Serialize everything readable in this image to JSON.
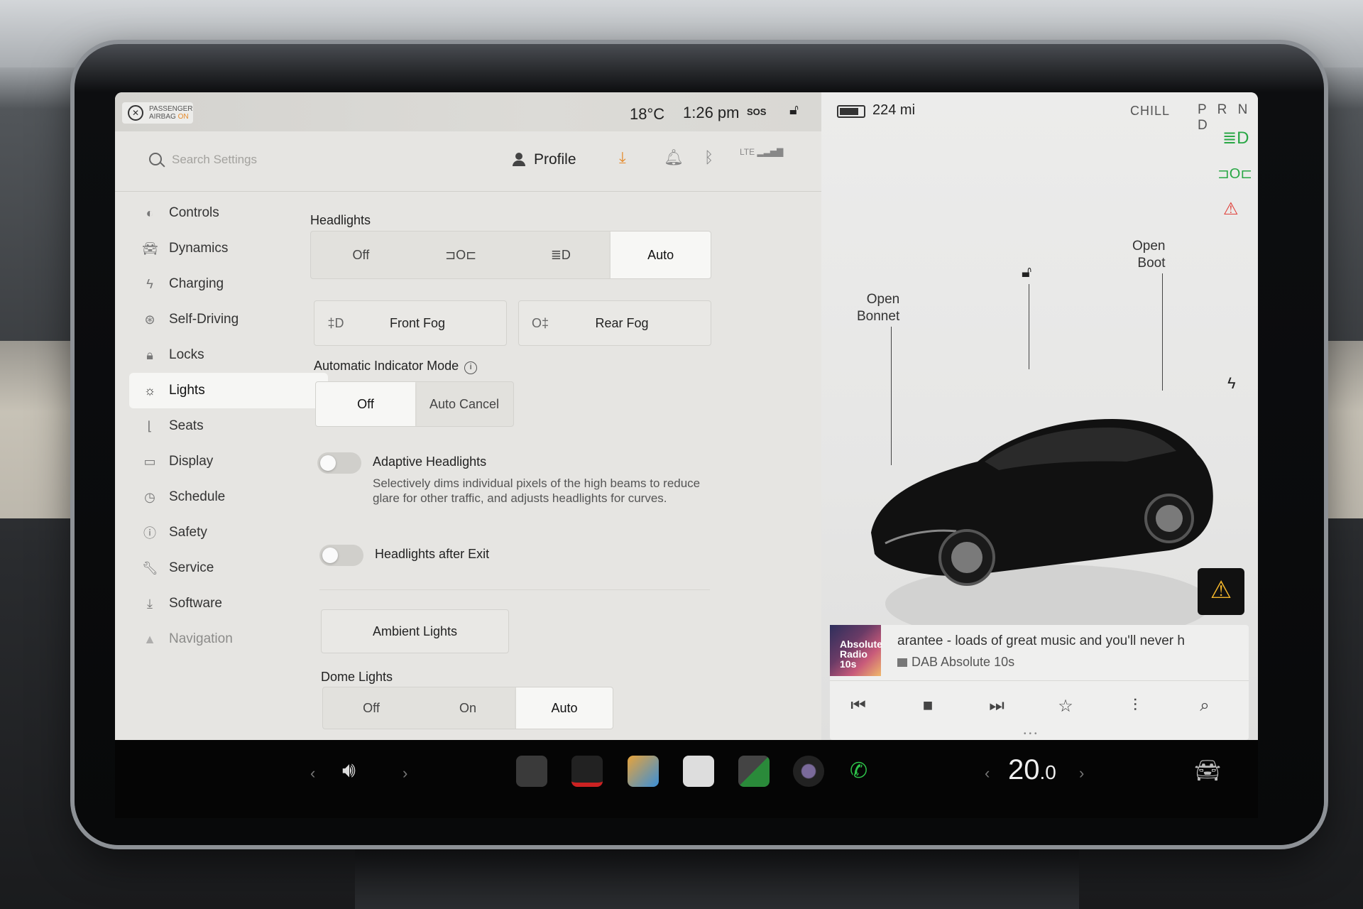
{
  "status": {
    "airbag_line1": "PASSENGER",
    "airbag_line2": "AIRBAG",
    "airbag_state": "ON",
    "temperature": "18°C",
    "time": "1:26 pm",
    "sos": "SOS"
  },
  "header": {
    "search_placeholder": "Search Settings",
    "profile_label": "Profile",
    "lte_label": "LTE"
  },
  "sidebar": {
    "items": [
      {
        "label": "Controls",
        "icon": "toggle-icon"
      },
      {
        "label": "Dynamics",
        "icon": "car-icon"
      },
      {
        "label": "Charging",
        "icon": "bolt-icon"
      },
      {
        "label": "Self-Driving",
        "icon": "steering-wheel-icon"
      },
      {
        "label": "Locks",
        "icon": "lock-icon"
      },
      {
        "label": "Lights",
        "icon": "sun-icon"
      },
      {
        "label": "Seats",
        "icon": "seat-icon"
      },
      {
        "label": "Display",
        "icon": "display-icon"
      },
      {
        "label": "Schedule",
        "icon": "clock-icon"
      },
      {
        "label": "Safety",
        "icon": "info-icon"
      },
      {
        "label": "Service",
        "icon": "wrench-icon"
      },
      {
        "label": "Software",
        "icon": "download-icon"
      },
      {
        "label": "Navigation",
        "icon": "navigation-icon"
      }
    ],
    "active": "Lights"
  },
  "lights": {
    "headlights_label": "Headlights",
    "headlights_options": [
      "Off",
      "parking",
      "low-beam",
      "Auto"
    ],
    "headlights_off": "Off",
    "headlights_auto": "Auto",
    "headlights_selected": "Auto",
    "front_fog": "Front Fog",
    "rear_fog": "Rear Fog",
    "indicator_mode_label": "Automatic Indicator Mode",
    "indicator_off": "Off",
    "indicator_auto_cancel": "Auto Cancel",
    "indicator_selected": "Off",
    "adaptive_label": "Adaptive Headlights",
    "adaptive_desc": "Selectively dims individual pixels of the high beams to reduce glare for other traffic, and adjusts headlights for curves.",
    "adaptive_on": false,
    "after_exit_label": "Headlights after Exit",
    "after_exit_on": false,
    "ambient_label": "Ambient Lights",
    "dome_label": "Dome Lights",
    "dome_off": "Off",
    "dome_on": "On",
    "dome_auto": "Auto",
    "dome_selected": "Auto"
  },
  "car": {
    "range": "224 mi",
    "drive_mode": "CHILL",
    "gear": "P R N D",
    "open_bonnet_1": "Open",
    "open_bonnet_2": "Bonnet",
    "open_boot_1": "Open",
    "open_boot_2": "Boot"
  },
  "media": {
    "song": "arantee - loads of great music and you'll never h",
    "station": "DAB Absolute 10s",
    "art_text": "Absolute Radio 10s"
  },
  "taskbar": {
    "cabin_temp_int": "20",
    "cabin_temp_dec": ".0"
  },
  "colors": {
    "accent_orange": "#e58a2a",
    "indicator_green": "#28a745",
    "alert_yellow": "#f2b52b"
  }
}
